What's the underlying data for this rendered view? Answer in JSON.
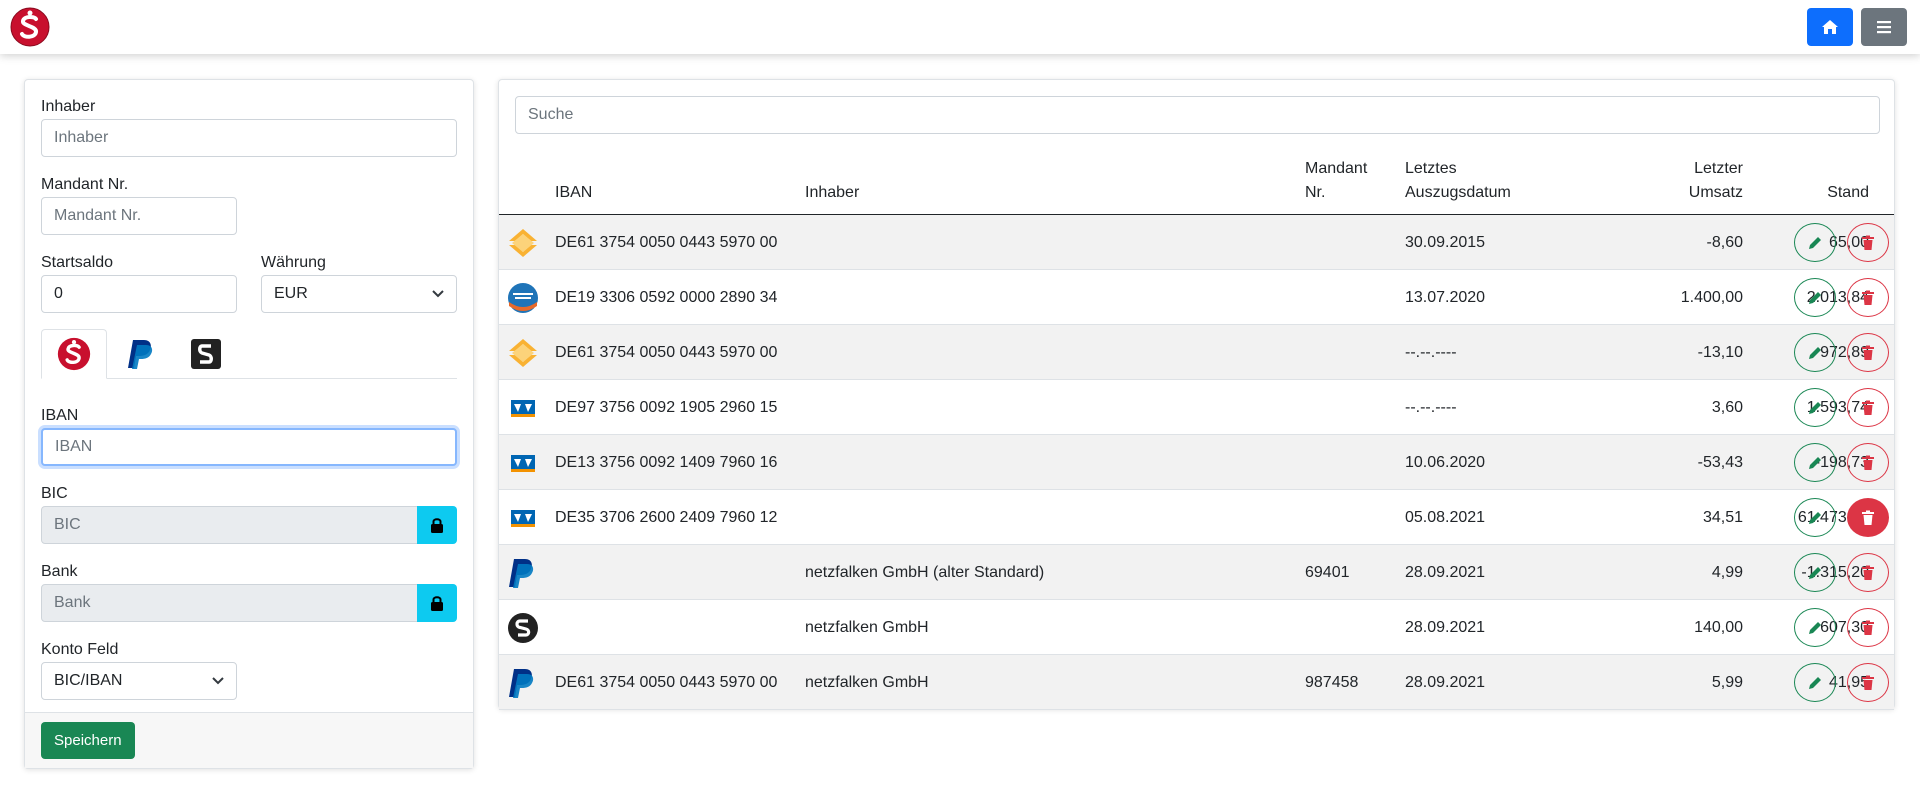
{
  "header": {
    "home_icon": "home-icon",
    "menu_icon": "hamburger-menu-icon"
  },
  "form": {
    "inhaber": {
      "label": "Inhaber",
      "placeholder": "Inhaber",
      "value": ""
    },
    "mandant": {
      "label": "Mandant Nr.",
      "placeholder": "Mandant Nr.",
      "value": ""
    },
    "startsaldo": {
      "label": "Startsaldo",
      "value": "0"
    },
    "waehrung": {
      "label": "Währung",
      "value": "EUR"
    },
    "tabs": [
      {
        "icon": "sparkasse-logo-icon",
        "active": true
      },
      {
        "icon": "paypal-logo-icon",
        "active": false
      },
      {
        "icon": "s-app-logo-icon",
        "active": false
      }
    ],
    "iban": {
      "label": "IBAN",
      "placeholder": "IBAN",
      "value": ""
    },
    "bic": {
      "label": "BIC",
      "placeholder": "BIC"
    },
    "bank": {
      "label": "Bank",
      "placeholder": "Bank"
    },
    "konto_feld": {
      "label": "Konto Feld",
      "value": "BIC/IBAN"
    },
    "save_label": "Speichern"
  },
  "table": {
    "search_placeholder": "Suche",
    "headers": {
      "iban": "IBAN",
      "inhaber": "Inhaber",
      "mandant_1": "Mandant",
      "mandant_2": "Nr.",
      "datum_1": "Letztes",
      "datum_2": "Auszugsdatum",
      "umsatz_1": "Letzter",
      "umsatz_2": "Umsatz",
      "stand": "Stand"
    },
    "rows": [
      {
        "icon": "commerzbank-icon",
        "iban": "DE61 3754 0050 0443 5970 00",
        "inhaber": "",
        "mandant": "",
        "datum": "30.09.2015",
        "umsatz": "-8,60",
        "stand": "65,00"
      },
      {
        "icon": "sparda-bank-icon",
        "iban": "DE19 3306 0592 0000 2890 34",
        "inhaber": "",
        "mandant": "",
        "datum": "13.07.2020",
        "umsatz": "1.400,00",
        "stand": "2.013,84"
      },
      {
        "icon": "commerzbank-icon",
        "iban": "DE61 3754 0050 0443 5970 00",
        "inhaber": "",
        "mandant": "",
        "datum": "--.--.----",
        "umsatz": "-13,10",
        "stand": "972,89"
      },
      {
        "icon": "volksbank-icon",
        "iban": "DE97 3756 0092 1905 2960 15",
        "inhaber": "",
        "mandant": "",
        "datum": "--.--.----",
        "umsatz": "3,60",
        "stand": "1.593,74"
      },
      {
        "icon": "volksbank-icon",
        "iban": "DE13 3756 0092 1409 7960 16",
        "inhaber": "",
        "mandant": "",
        "datum": "10.06.2020",
        "umsatz": "-53,43",
        "stand": "-198,73"
      },
      {
        "icon": "volksbank-icon",
        "iban": "DE35 3706 2600 2409 7960 12",
        "inhaber": "",
        "mandant": "",
        "datum": "05.08.2021",
        "umsatz": "34,51",
        "stand": "61.473,93"
      },
      {
        "icon": "paypal-icon",
        "iban": "",
        "inhaber": "netzfalken GmbH (alter Standard)",
        "mandant": "69401",
        "datum": "28.09.2021",
        "umsatz": "4,99",
        "stand": "-1.315,20"
      },
      {
        "icon": "s-app-icon",
        "iban": "",
        "inhaber": "netzfalken GmbH",
        "mandant": "",
        "datum": "28.09.2021",
        "umsatz": "140,00",
        "stand": "607,30"
      },
      {
        "icon": "paypal-icon",
        "iban": "DE61 3754 0050 0443 5970 00",
        "inhaber": "netzfalken GmbH",
        "mandant": "987458",
        "datum": "28.09.2021",
        "umsatz": "5,99",
        "stand": "41,95"
      }
    ]
  },
  "colors": {
    "primary": "#0d6efd",
    "secondary": "#6c757d",
    "success": "#198754",
    "danger": "#dc3545",
    "info": "#0dcaf0",
    "sparkasse_red": "#c8102e"
  }
}
